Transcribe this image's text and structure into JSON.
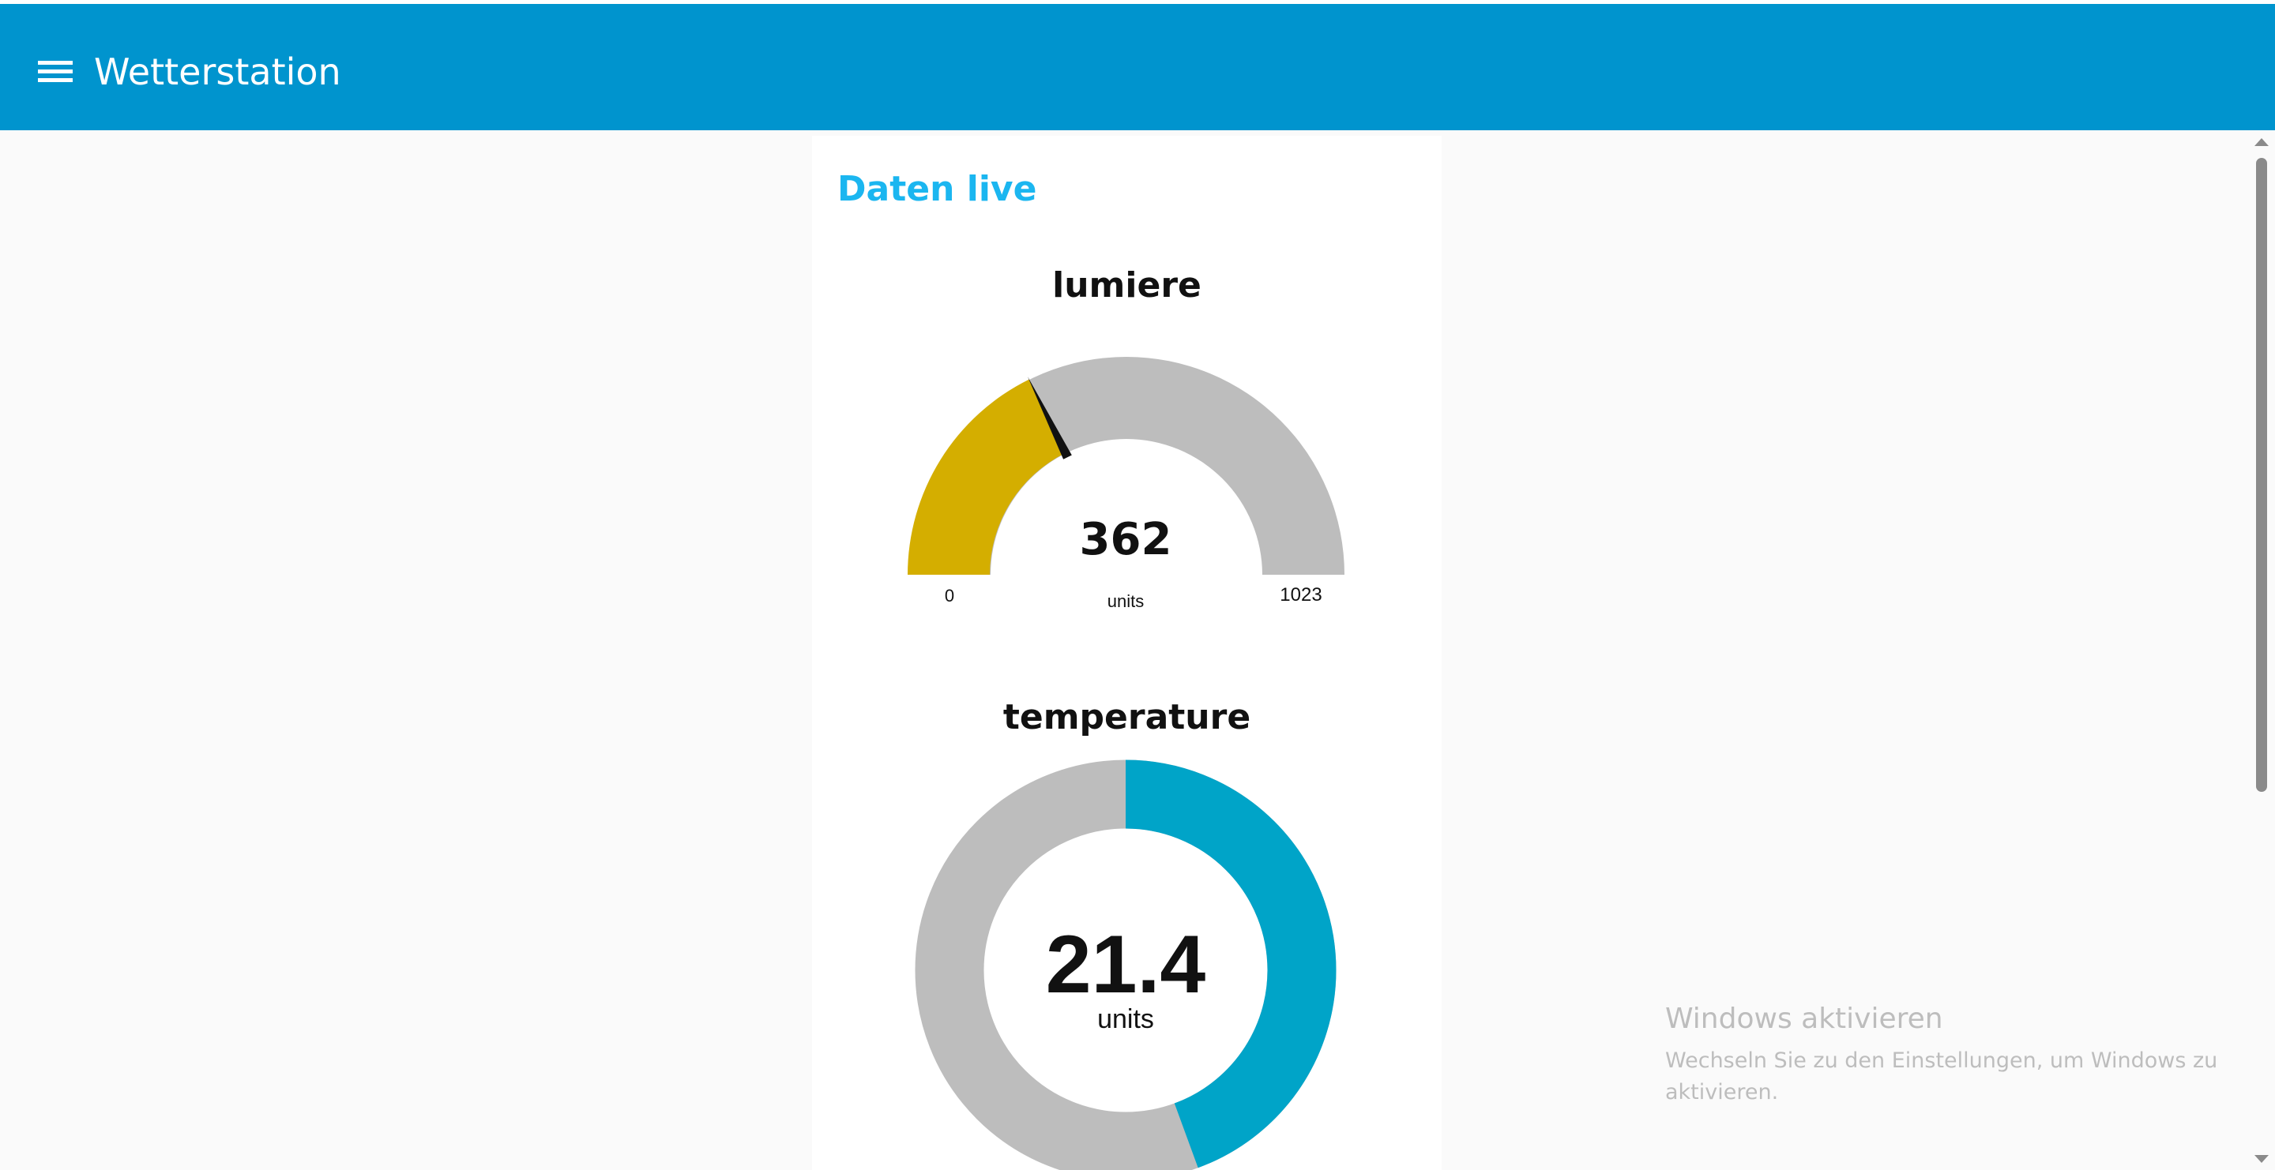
{
  "app": {
    "title": "Wetterstation",
    "menu_icon": "hamburger-menu-icon"
  },
  "group": {
    "title": "Daten live"
  },
  "widgets": [
    {
      "title": "lumiere",
      "type": "gauge",
      "value": "362",
      "unit": "units",
      "min": "0",
      "max": "1023",
      "color": "#d4ae00",
      "track_color": "#bdbdbd",
      "needle_color": "#111111"
    },
    {
      "title": "temperature",
      "type": "donut",
      "value": "21.4",
      "unit": "units",
      "fill_fraction": 0.444,
      "color": "#00a4c8",
      "track_color": "#bdbdbd"
    }
  ],
  "watermark": {
    "title": "Windows aktivieren",
    "text": "Wechseln Sie zu den Einstellungen, um Windows zu aktivieren."
  },
  "colors": {
    "header": "#0094ce",
    "group_title": "#1bb6f0",
    "background": "#fafafa"
  }
}
